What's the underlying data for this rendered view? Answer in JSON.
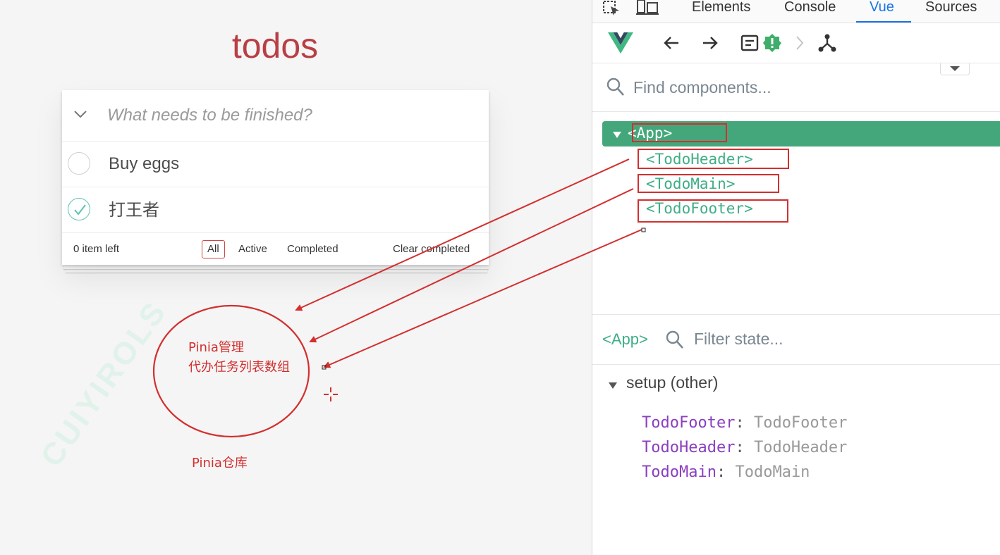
{
  "app": {
    "title": "todos",
    "new_todo_placeholder": "What needs to be finished?",
    "todos": [
      {
        "label": "Buy eggs",
        "completed": false
      },
      {
        "label": "打王者",
        "completed": true
      }
    ],
    "footer": {
      "count": "0 item left",
      "filters": [
        "All",
        "Active",
        "Completed"
      ],
      "selected_filter": "All",
      "clear_completed": "Clear completed"
    }
  },
  "annotations": {
    "circle_text_line1": "Pinia管理",
    "circle_text_line2": "代办任务列表数组",
    "store_label": "Pinia仓库",
    "watermark": "CUIYIROLS",
    "color": "#d32f2f"
  },
  "devtools": {
    "tabs": [
      "Elements",
      "Console",
      "Vue",
      "Sources"
    ],
    "active_tab": "Vue",
    "toolbar_icons": [
      "inspect-element-icon",
      "device-toggle-icon",
      "vue-logo-icon",
      "back-arrow-icon",
      "forward-arrow-icon",
      "timeline-icon",
      "warning-badge-icon",
      "component-tree-icon"
    ],
    "find_placeholder": "Find components...",
    "tree": {
      "root": "<App>",
      "children": [
        "<TodoHeader>",
        "<TodoMain>",
        "<TodoFooter>"
      ]
    },
    "state": {
      "selected": "<App>",
      "filter_placeholder": "Filter state...",
      "section": "setup (other)",
      "entries": [
        {
          "key": "TodoFooter",
          "value": "TodoFooter"
        },
        {
          "key": "TodoHeader",
          "value": "TodoHeader"
        },
        {
          "key": "TodoMain",
          "value": "TodoMain"
        }
      ]
    },
    "colors": {
      "accent": "#44a77b",
      "active_tab": "#1a73e8",
      "state_key": "#8a3fc0"
    }
  }
}
